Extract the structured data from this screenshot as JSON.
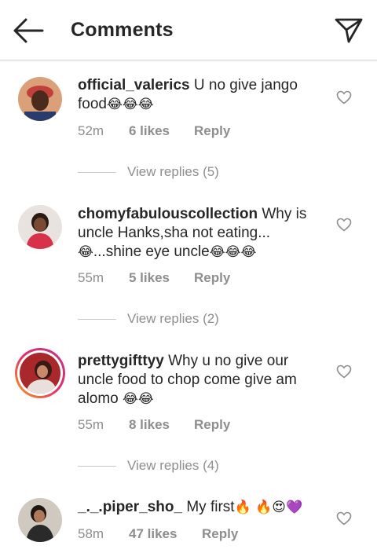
{
  "header": {
    "title": "Comments",
    "back_icon": "arrow-left-icon",
    "share_icon": "paper-plane-icon"
  },
  "comments": [
    {
      "username": "official_valerics",
      "text": " U no give jango food",
      "emoji": "😂😂😂",
      "time": "52m",
      "likes": "6 likes",
      "reply": "Reply",
      "view_replies": "View replies (5)"
    },
    {
      "username": "chomyfabulouscollection",
      "text": " Why is uncle Hanks,sha not eating...",
      "emoji_pre": "😂",
      "text2": "...shine eye uncle",
      "emoji": "😂😂😂",
      "time": "55m",
      "likes": "5 likes",
      "reply": "Reply",
      "view_replies": "View replies (2)"
    },
    {
      "username": "prettygifttyy",
      "text": " Why u no give our uncle food to chop come give am alomo ",
      "emoji": "😂😂",
      "time": "55m",
      "likes": "8 likes",
      "reply": "Reply",
      "view_replies": "View replies (4)"
    },
    {
      "username": "_._.piper_sho_",
      "text": " My first",
      "emoji": "🔥 🔥😍💜",
      "time": "58m",
      "likes": "47 likes",
      "reply": "Reply"
    }
  ],
  "colors": {
    "text": "#262626",
    "secondary": "#8e8e8e",
    "divider": "#dbdbdb",
    "story_ring_start": "#f9a01b",
    "story_ring_end": "#c13584"
  }
}
